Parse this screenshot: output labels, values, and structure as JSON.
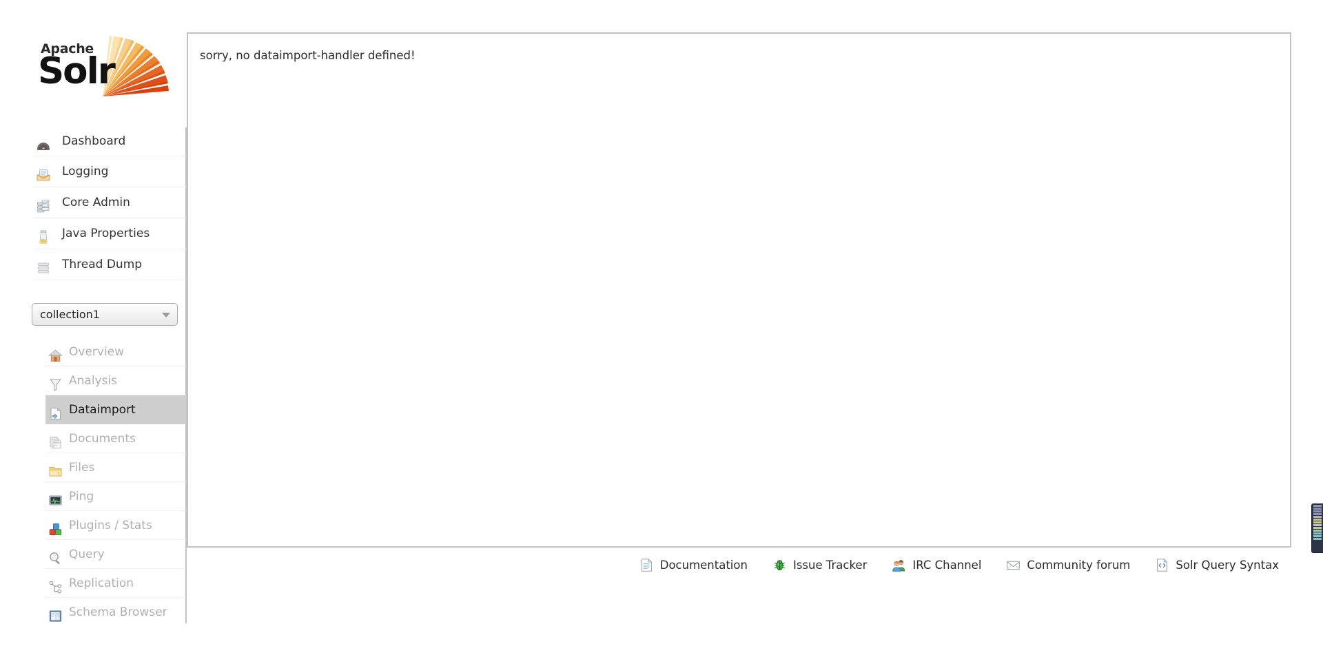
{
  "brand": {
    "apache": "Apache",
    "solr": "Solr",
    "logo_colors": [
      "#f5a623",
      "#ef7c2a",
      "#e2541f",
      "#f7c873",
      "#fbe3b0"
    ]
  },
  "sidebar": {
    "top_menu": [
      {
        "label": "Dashboard",
        "icon": "dashboard-icon"
      },
      {
        "label": "Logging",
        "icon": "logging-icon"
      },
      {
        "label": "Core Admin",
        "icon": "core-admin-icon"
      },
      {
        "label": "Java Properties",
        "icon": "java-properties-icon"
      },
      {
        "label": "Thread Dump",
        "icon": "thread-dump-icon"
      }
    ],
    "core_selector": {
      "selected": "collection1",
      "options": [
        "collection1"
      ]
    },
    "core_menu": [
      {
        "label": "Overview",
        "icon": "home-icon",
        "active": false
      },
      {
        "label": "Analysis",
        "icon": "funnel-icon",
        "active": false
      },
      {
        "label": "Dataimport",
        "icon": "dataimport-icon",
        "active": true
      },
      {
        "label": "Documents",
        "icon": "documents-icon",
        "active": false
      },
      {
        "label": "Files",
        "icon": "folder-icon",
        "active": false
      },
      {
        "label": "Ping",
        "icon": "ping-icon",
        "active": false
      },
      {
        "label": "Plugins / Stats",
        "icon": "plugins-icon",
        "active": false
      },
      {
        "label": "Query",
        "icon": "magnifier-icon",
        "active": false
      },
      {
        "label": "Replication",
        "icon": "replication-icon",
        "active": false
      },
      {
        "label": "Schema Browser",
        "icon": "book-icon",
        "active": false
      }
    ]
  },
  "content": {
    "message": "sorry, no dataimport-handler defined!"
  },
  "footer": {
    "links": [
      {
        "label": "Documentation",
        "icon": "document-icon"
      },
      {
        "label": "Issue Tracker",
        "icon": "bug-icon"
      },
      {
        "label": "IRC Channel",
        "icon": "people-icon"
      },
      {
        "label": "Community forum",
        "icon": "envelope-icon"
      },
      {
        "label": "Solr Query Syntax",
        "icon": "code-document-icon"
      }
    ]
  },
  "edge_gauge": {
    "segment_colors": [
      "#8f94b8",
      "#8f94b8",
      "#8f94b8",
      "#8f94b8",
      "#b9b58a",
      "#c9c47e",
      "#cfcf7a",
      "#cfcf7a",
      "#b8cf8e",
      "#8fcfae",
      "#7ccfbc",
      "#74c9c4",
      "#74c9c4"
    ]
  }
}
